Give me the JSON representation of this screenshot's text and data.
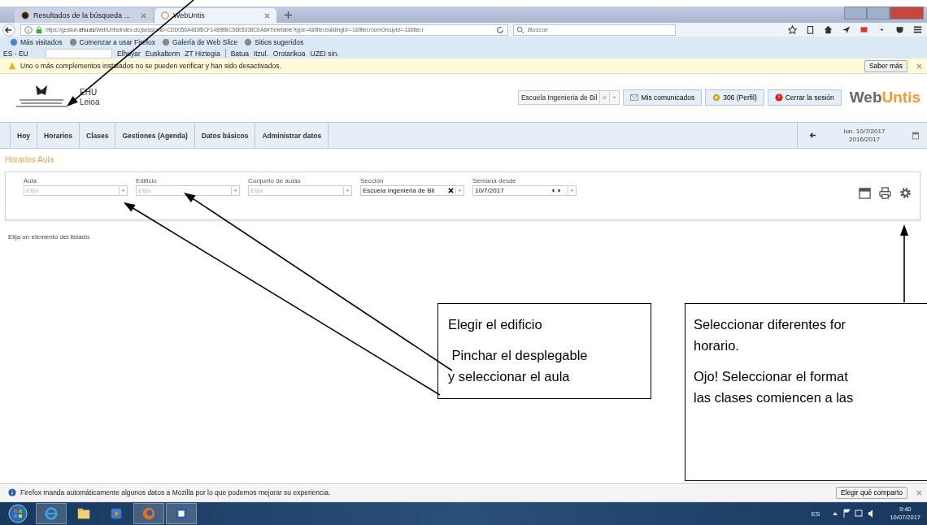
{
  "browser": {
    "tabs": [
      {
        "label": "Resultados de la búsqueda ...",
        "selected": false
      },
      {
        "label": "WebUntis",
        "selected": true
      }
    ],
    "url": {
      "prefix": "https://gestion.",
      "host": "ehu.es",
      "rest": "/WebUntis/index.do;jsessionid=CDD056A483f6CF14898BC56E5338CEA6#Timetable?type=4&filter.buildingId=-1&filter.roomGroupId=-1&filter.r"
    },
    "search": {
      "placeholder": "Buscar"
    },
    "bookmarks": [
      "Más visitados",
      "Comenzar a usar Firefox",
      "Galería de Web Slice",
      "Sitios sugeridos"
    ],
    "toolbar": {
      "language": "ES - EU",
      "links": [
        "Elhuyar",
        "Euskalterm",
        "ZT Hiztegia"
      ],
      "links_2": [
        "Batua",
        "Itzul.",
        "Orotarikoa",
        "UZEI sin."
      ]
    },
    "warning": {
      "text": "Uno o más complementos instalados no se pueden verificar y han sido desactivados.",
      "button": "Saber más"
    }
  },
  "header": {
    "logo_lines": [
      "EHU",
      "Leioa"
    ],
    "school": "Escuela Ingenieria de Bil",
    "buttons": [
      {
        "kind": "mail",
        "label": "Mis comunicados"
      },
      {
        "kind": "profile",
        "label": "306 (Perfil)"
      },
      {
        "kind": "logout",
        "label": "Cerrar la sesión"
      }
    ],
    "brand": [
      "Web",
      "Untis"
    ]
  },
  "menu": [
    "Hoy",
    "Horarios",
    "Clases",
    "Gestiones (Agenda)",
    "Datos básicos",
    "Administrar datos"
  ],
  "date": {
    "day": "lun. 10/7/2017",
    "year": "2016/2017"
  },
  "page_title": "Horarios Aula",
  "filters": [
    {
      "kind": "select",
      "label": "Aula",
      "placeholder": "Elija"
    },
    {
      "kind": "select",
      "label": "Edificio",
      "placeholder": "Elija"
    },
    {
      "kind": "select",
      "label": "Conjunto de aulas",
      "placeholder": "Elija"
    },
    {
      "kind": "clearable",
      "label": "Sección",
      "value": "Escuela Ingenieria de Bil"
    },
    {
      "kind": "date",
      "label": "Semana desde",
      "value": "10/7/2017"
    }
  ],
  "message": "Elija un elemento del listado.",
  "telemetry": {
    "text": "Firefox manda automáticamente algunos datos a Mozilla por lo que podemos mejorar su experiencia.",
    "button": "Elegir qué comparto"
  },
  "taskbar": {
    "language": "ES",
    "time": "9:40",
    "date": "10/07/2017"
  },
  "callouts": [
    {
      "lines": [
        "Elegir el edificio",
        " Pinchar el desplegable",
        "y seleccionar el aula"
      ]
    },
    {
      "lines": [
        "Seleccionar diferentes for",
        "horario.",
        "Ojo! Seleccionar el format",
        "las clases comiencen a las"
      ]
    }
  ]
}
